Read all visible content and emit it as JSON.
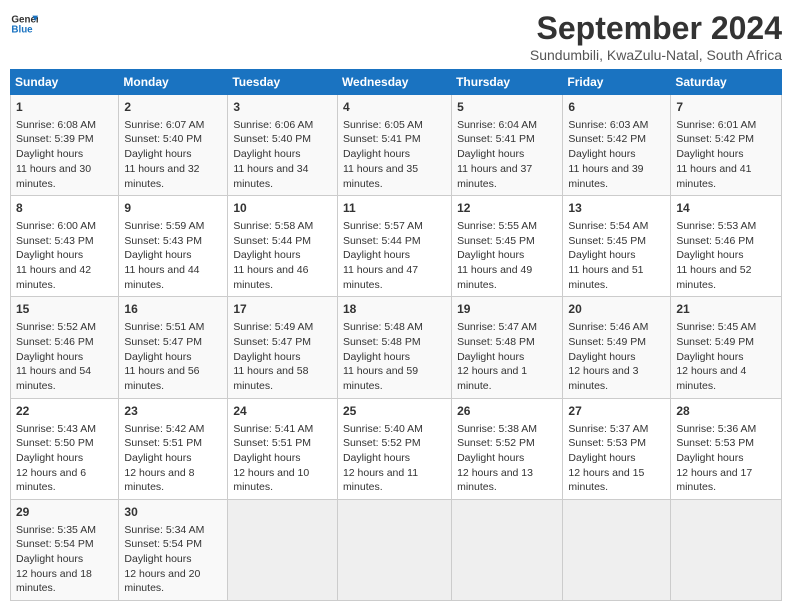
{
  "logo": {
    "line1": "General",
    "line2": "Blue"
  },
  "title": "September 2024",
  "subtitle": "Sundumbili, KwaZulu-Natal, South Africa",
  "days_of_week": [
    "Sunday",
    "Monday",
    "Tuesday",
    "Wednesday",
    "Thursday",
    "Friday",
    "Saturday"
  ],
  "weeks": [
    [
      {
        "day": 1,
        "sunrise": "6:08 AM",
        "sunset": "5:39 PM",
        "daylight": "11 hours and 30 minutes."
      },
      {
        "day": 2,
        "sunrise": "6:07 AM",
        "sunset": "5:40 PM",
        "daylight": "11 hours and 32 minutes."
      },
      {
        "day": 3,
        "sunrise": "6:06 AM",
        "sunset": "5:40 PM",
        "daylight": "11 hours and 34 minutes."
      },
      {
        "day": 4,
        "sunrise": "6:05 AM",
        "sunset": "5:41 PM",
        "daylight": "11 hours and 35 minutes."
      },
      {
        "day": 5,
        "sunrise": "6:04 AM",
        "sunset": "5:41 PM",
        "daylight": "11 hours and 37 minutes."
      },
      {
        "day": 6,
        "sunrise": "6:03 AM",
        "sunset": "5:42 PM",
        "daylight": "11 hours and 39 minutes."
      },
      {
        "day": 7,
        "sunrise": "6:01 AM",
        "sunset": "5:42 PM",
        "daylight": "11 hours and 41 minutes."
      }
    ],
    [
      {
        "day": 8,
        "sunrise": "6:00 AM",
        "sunset": "5:43 PM",
        "daylight": "11 hours and 42 minutes."
      },
      {
        "day": 9,
        "sunrise": "5:59 AM",
        "sunset": "5:43 PM",
        "daylight": "11 hours and 44 minutes."
      },
      {
        "day": 10,
        "sunrise": "5:58 AM",
        "sunset": "5:44 PM",
        "daylight": "11 hours and 46 minutes."
      },
      {
        "day": 11,
        "sunrise": "5:57 AM",
        "sunset": "5:44 PM",
        "daylight": "11 hours and 47 minutes."
      },
      {
        "day": 12,
        "sunrise": "5:55 AM",
        "sunset": "5:45 PM",
        "daylight": "11 hours and 49 minutes."
      },
      {
        "day": 13,
        "sunrise": "5:54 AM",
        "sunset": "5:45 PM",
        "daylight": "11 hours and 51 minutes."
      },
      {
        "day": 14,
        "sunrise": "5:53 AM",
        "sunset": "5:46 PM",
        "daylight": "11 hours and 52 minutes."
      }
    ],
    [
      {
        "day": 15,
        "sunrise": "5:52 AM",
        "sunset": "5:46 PM",
        "daylight": "11 hours and 54 minutes."
      },
      {
        "day": 16,
        "sunrise": "5:51 AM",
        "sunset": "5:47 PM",
        "daylight": "11 hours and 56 minutes."
      },
      {
        "day": 17,
        "sunrise": "5:49 AM",
        "sunset": "5:47 PM",
        "daylight": "11 hours and 58 minutes."
      },
      {
        "day": 18,
        "sunrise": "5:48 AM",
        "sunset": "5:48 PM",
        "daylight": "11 hours and 59 minutes."
      },
      {
        "day": 19,
        "sunrise": "5:47 AM",
        "sunset": "5:48 PM",
        "daylight": "12 hours and 1 minute."
      },
      {
        "day": 20,
        "sunrise": "5:46 AM",
        "sunset": "5:49 PM",
        "daylight": "12 hours and 3 minutes."
      },
      {
        "day": 21,
        "sunrise": "5:45 AM",
        "sunset": "5:49 PM",
        "daylight": "12 hours and 4 minutes."
      }
    ],
    [
      {
        "day": 22,
        "sunrise": "5:43 AM",
        "sunset": "5:50 PM",
        "daylight": "12 hours and 6 minutes."
      },
      {
        "day": 23,
        "sunrise": "5:42 AM",
        "sunset": "5:51 PM",
        "daylight": "12 hours and 8 minutes."
      },
      {
        "day": 24,
        "sunrise": "5:41 AM",
        "sunset": "5:51 PM",
        "daylight": "12 hours and 10 minutes."
      },
      {
        "day": 25,
        "sunrise": "5:40 AM",
        "sunset": "5:52 PM",
        "daylight": "12 hours and 11 minutes."
      },
      {
        "day": 26,
        "sunrise": "5:38 AM",
        "sunset": "5:52 PM",
        "daylight": "12 hours and 13 minutes."
      },
      {
        "day": 27,
        "sunrise": "5:37 AM",
        "sunset": "5:53 PM",
        "daylight": "12 hours and 15 minutes."
      },
      {
        "day": 28,
        "sunrise": "5:36 AM",
        "sunset": "5:53 PM",
        "daylight": "12 hours and 17 minutes."
      }
    ],
    [
      {
        "day": 29,
        "sunrise": "5:35 AM",
        "sunset": "5:54 PM",
        "daylight": "12 hours and 18 minutes."
      },
      {
        "day": 30,
        "sunrise": "5:34 AM",
        "sunset": "5:54 PM",
        "daylight": "12 hours and 20 minutes."
      },
      null,
      null,
      null,
      null,
      null
    ]
  ]
}
